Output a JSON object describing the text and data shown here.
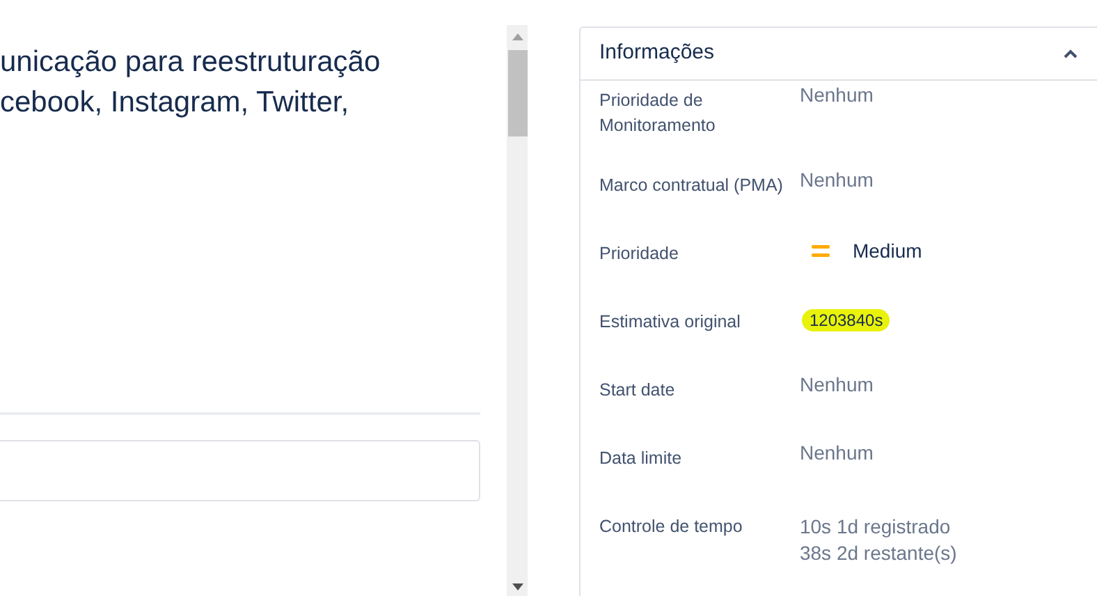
{
  "description": {
    "lines": [
      "unicação para reestruturação",
      "cebook, Instagram, Twitter,"
    ]
  },
  "details_panel": {
    "title": "Informações",
    "expanded": true,
    "fields": [
      {
        "kind": "text",
        "label": "Prioridade de Monitoramento",
        "value": "Nenhum"
      },
      {
        "kind": "text",
        "label": "Marco contratual (PMA)",
        "value": "Nenhum"
      },
      {
        "kind": "priority",
        "label": "Prioridade",
        "value": "Medium"
      },
      {
        "kind": "badge",
        "label": "Estimativa original",
        "value": "1203840s",
        "highlighted": true
      },
      {
        "kind": "text",
        "label": "Start date",
        "value": "Nenhum"
      },
      {
        "kind": "text",
        "label": "Data limite",
        "value": "Nenhum"
      },
      {
        "kind": "lines",
        "label": "Controle de tempo",
        "lines": [
          "10s 1d registrado",
          "38s 2d restante(s)"
        ]
      }
    ]
  }
}
